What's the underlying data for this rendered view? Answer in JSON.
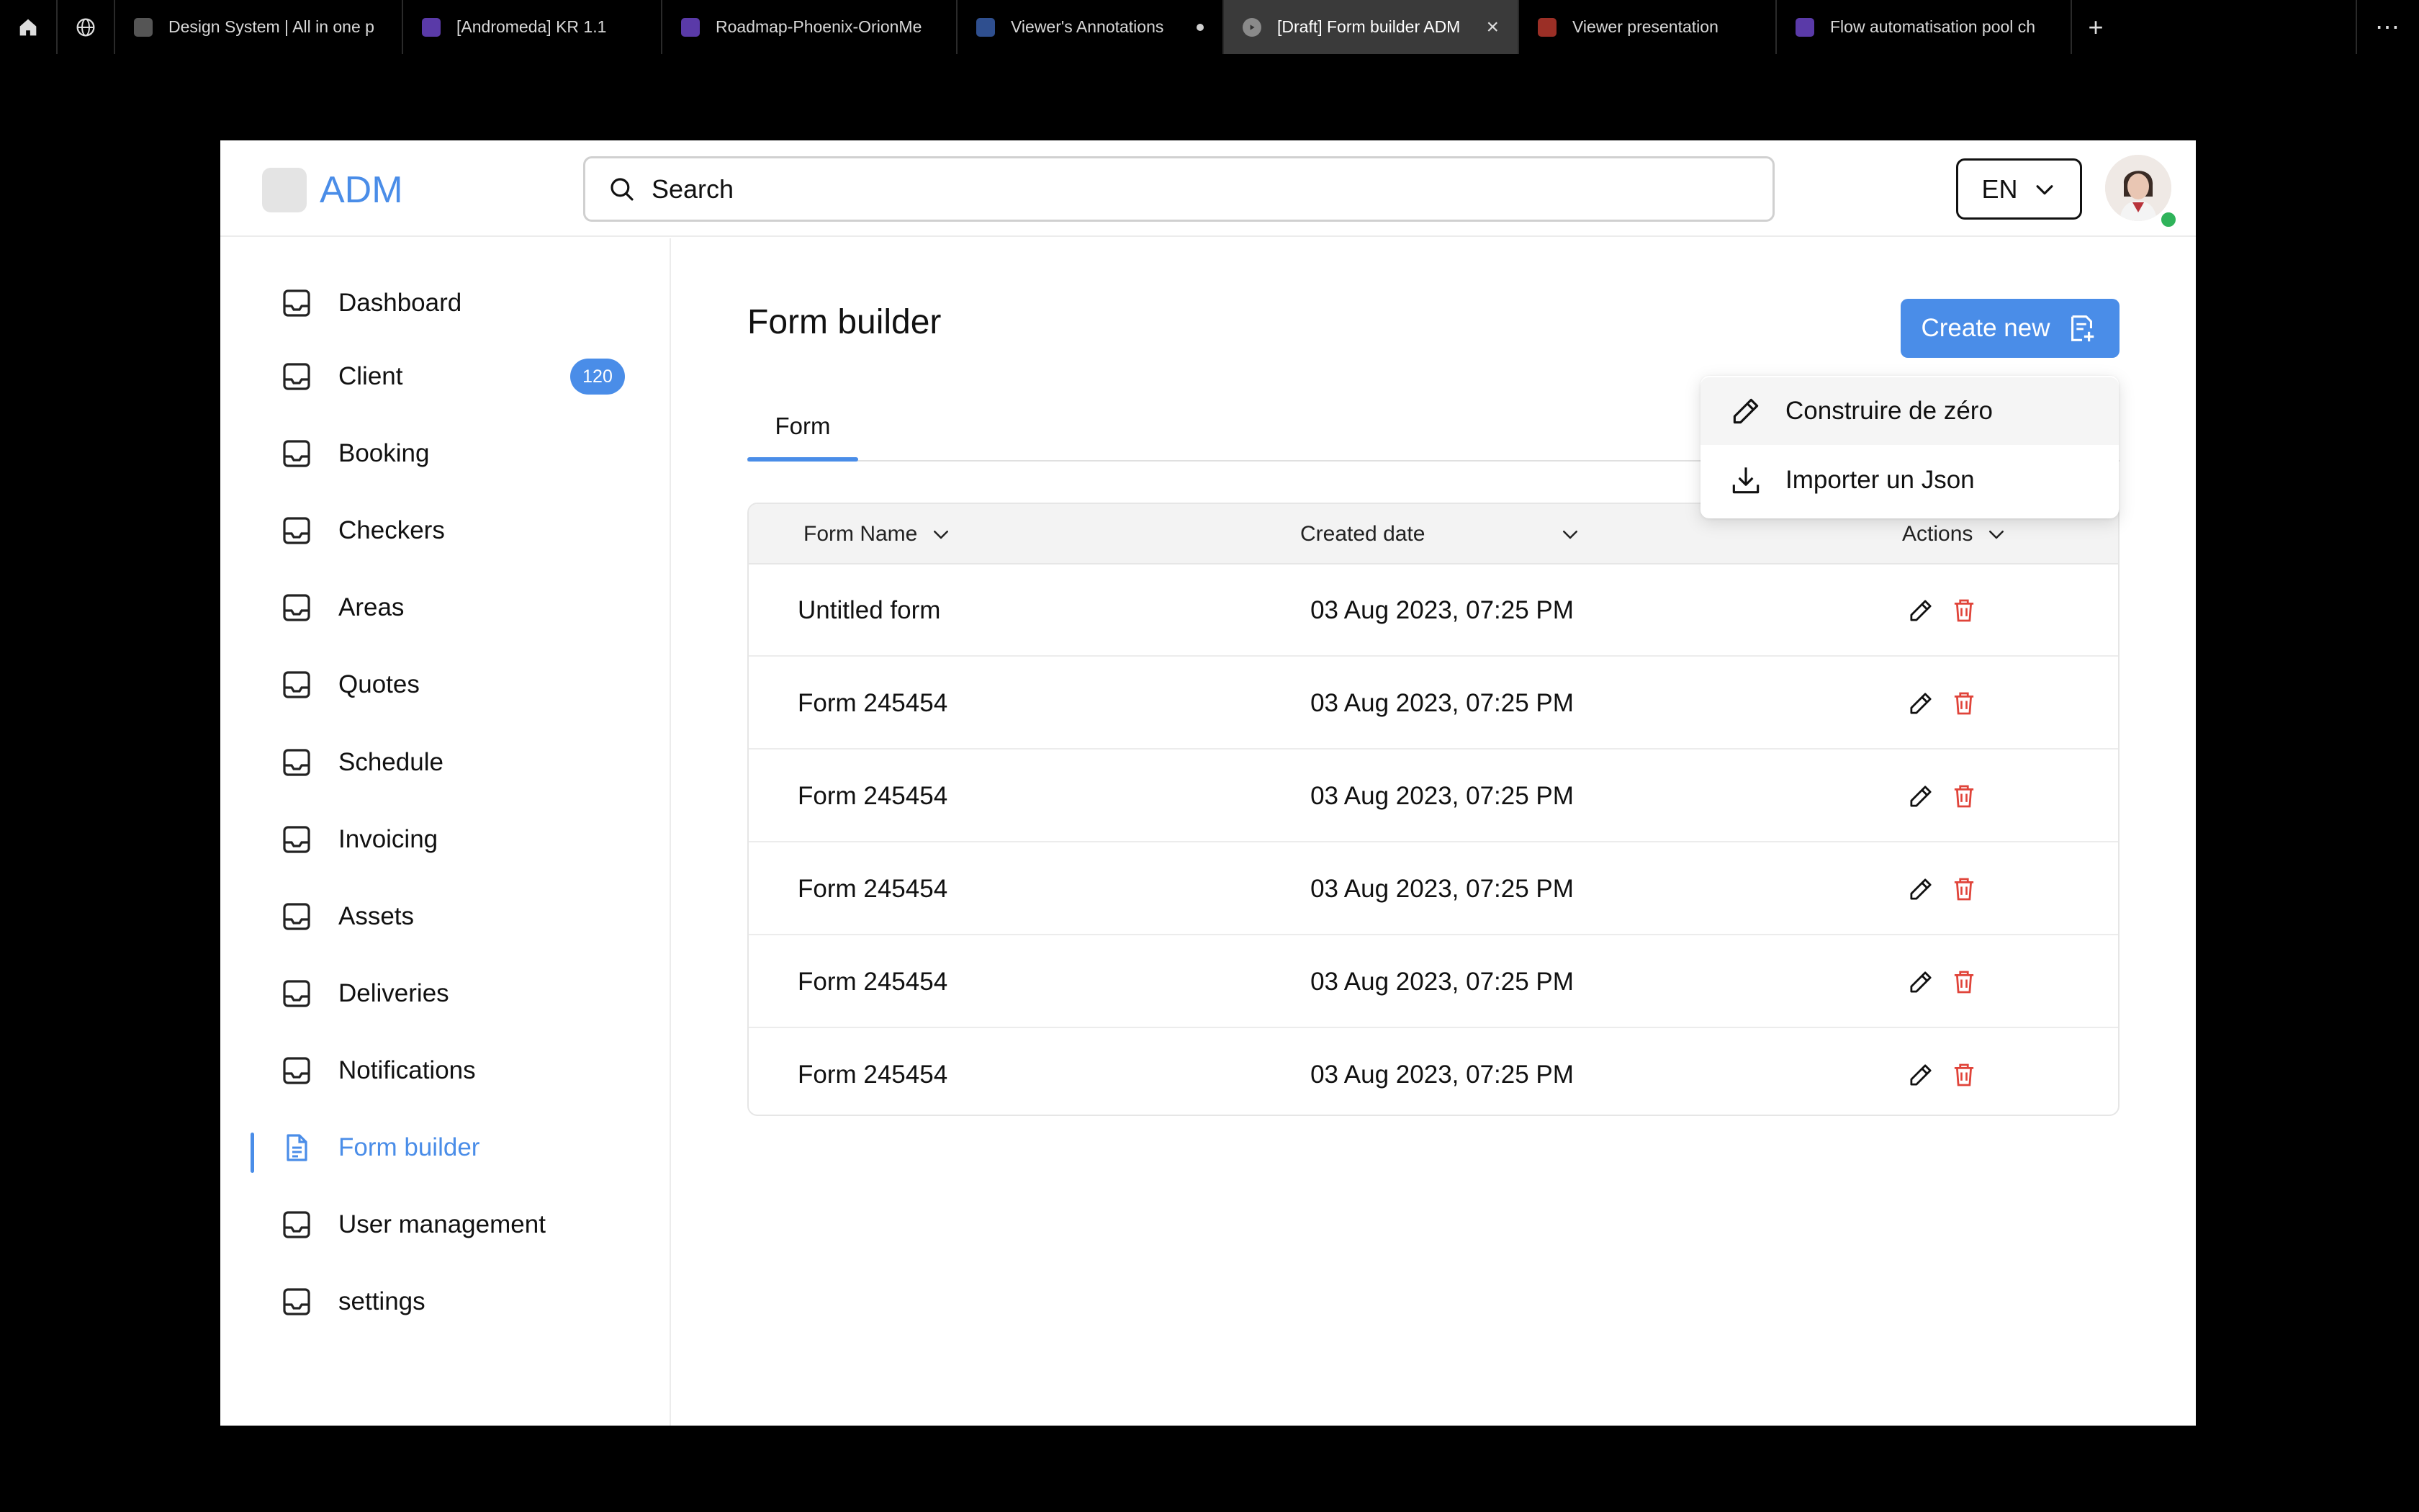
{
  "browser": {
    "tabs": [
      {
        "title": "Design System | All in one p",
        "favicon_color": "#6b6b6b"
      },
      {
        "title": "[Andromeda] KR 1.1",
        "favicon_color": "#7b4fd6"
      },
      {
        "title": "Roadmap-Phoenix-OrionMe",
        "favicon_color": "#7b4fd6"
      },
      {
        "title": "Viewer's Annotations",
        "favicon_color": "#3b5ca8"
      },
      {
        "title": "[Draft] Form builder ADM",
        "favicon_color": "#8a8a8a"
      },
      {
        "title": "Viewer presentation",
        "favicon_color": "#c0392b"
      },
      {
        "title": "Flow automatisation pool ch",
        "favicon_color": "#7b4fd6"
      }
    ],
    "new_tab": "+",
    "more": "⋯"
  },
  "header": {
    "logo": "ADM",
    "search_placeholder": "Search",
    "language": "EN"
  },
  "sidebar": {
    "items": [
      {
        "label": "Dashboard"
      },
      {
        "label": "Client",
        "badge": "120"
      },
      {
        "label": "Booking"
      },
      {
        "label": "Checkers"
      },
      {
        "label": "Areas"
      },
      {
        "label": "Quotes"
      },
      {
        "label": "Schedule"
      },
      {
        "label": "Invoicing"
      },
      {
        "label": "Assets"
      },
      {
        "label": "Deliveries"
      },
      {
        "label": "Notifications"
      },
      {
        "label": "Form builder",
        "active": true
      },
      {
        "label": "User management"
      },
      {
        "label": "settings"
      }
    ]
  },
  "main": {
    "title": "Form builder",
    "create_label": "Create new",
    "tabs": [
      {
        "label": "Form"
      }
    ],
    "dropdown": [
      {
        "label": "Construire de zéro",
        "icon": "pencil-icon"
      },
      {
        "label": "Importer un Json",
        "icon": "download-icon"
      }
    ],
    "table": {
      "columns": [
        "Form Name",
        "Created date",
        "Actions"
      ],
      "rows": [
        {
          "name": "Untitled form",
          "date": "03 Aug 2023, 07:25 PM"
        },
        {
          "name": "Form 245454",
          "date": "03 Aug 2023, 07:25 PM"
        },
        {
          "name": "Form 245454",
          "date": "03 Aug 2023, 07:25 PM"
        },
        {
          "name": "Form 245454",
          "date": "03 Aug 2023, 07:25 PM"
        },
        {
          "name": "Form 245454",
          "date": "03 Aug 2023, 07:25 PM"
        },
        {
          "name": "Form 245454",
          "date": "03 Aug 2023, 07:25 PM"
        }
      ]
    }
  },
  "colors": {
    "accent": "#4a8de8",
    "delete": "#e0443a",
    "presence": "#2fb35a"
  }
}
